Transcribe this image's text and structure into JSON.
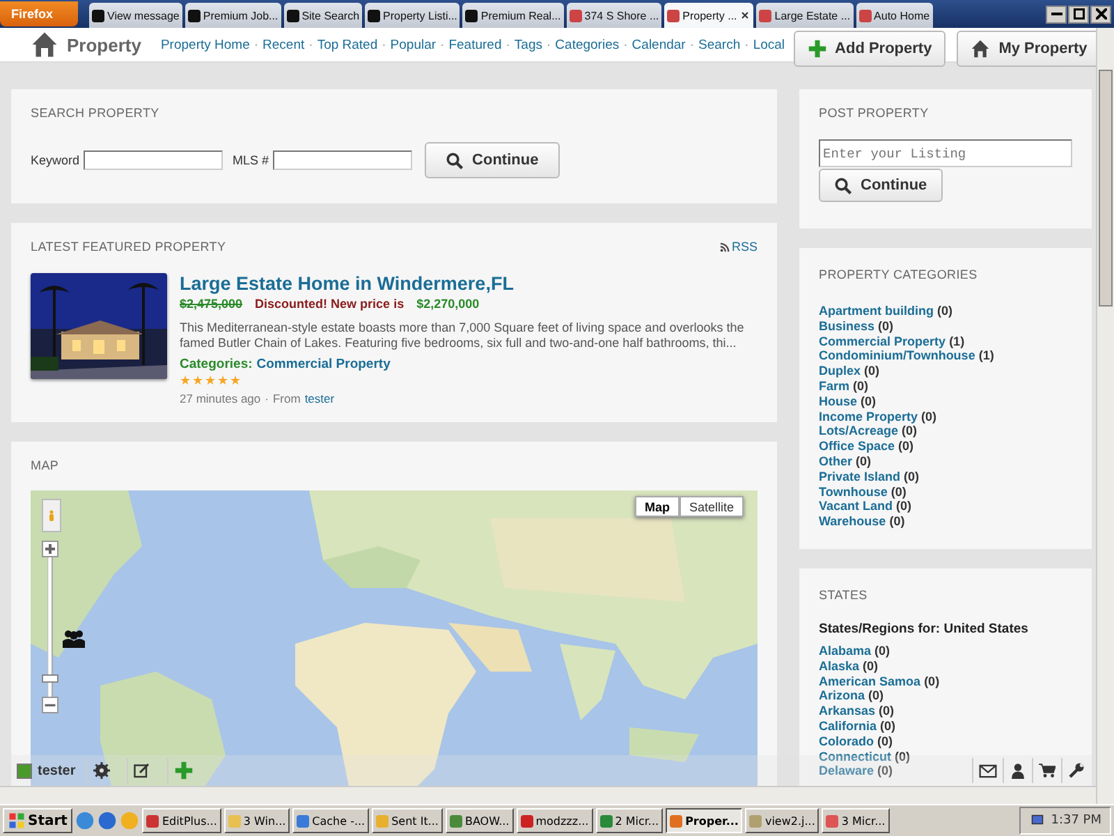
{
  "browser": {
    "menu_button": "Firefox",
    "tabs": [
      {
        "title": "View message",
        "selected": false
      },
      {
        "title": "Premium Job...",
        "selected": false
      },
      {
        "title": "Site Search",
        "selected": false
      },
      {
        "title": "Property Listi...",
        "selected": false
      },
      {
        "title": "Premium Real...",
        "selected": false
      },
      {
        "title": "374 S Shore ...",
        "selected": false
      },
      {
        "title": "Property ...",
        "selected": true
      },
      {
        "title": "Large Estate ...",
        "selected": false
      },
      {
        "title": "Auto Home",
        "selected": false
      }
    ]
  },
  "header": {
    "title": "Property",
    "nav_separator": "·",
    "nav": [
      "Property Home",
      "Recent",
      "Top Rated",
      "Popular",
      "Featured",
      "Tags",
      "Categories",
      "Calendar",
      "Search",
      "Local"
    ],
    "buttons": [
      {
        "label": "Add Property",
        "kind": "add"
      },
      {
        "label": "My Property",
        "kind": "home"
      }
    ]
  },
  "search": {
    "heading": "SEARCH PROPERTY",
    "keyword_label": "Keyword",
    "mls_label": "MLS #",
    "button": "Continue"
  },
  "featured": {
    "heading": "LATEST FEATURED PROPERTY",
    "rss": "RSS",
    "title": "Large Estate Home in Windermere,FL",
    "old_price": "$2,475,000",
    "discount_text": "Discounted! New price is",
    "new_price": "$2,270,000",
    "description": "This Mediterranean-style estate boasts more than 7,000 Square feet of living space and overlooks the famed Butler Chain of Lakes.  Featuring five bedrooms, six full and two-and-one half bathrooms, thi...",
    "categories_label": "Categories:",
    "category": "Commercial Property",
    "stars": 5,
    "time": "27 minutes ago",
    "meta_separator": "·",
    "from_label": "From",
    "author": "tester"
  },
  "map": {
    "heading": "MAP",
    "zoom": {
      "level": 0.1
    },
    "map_types": [
      {
        "label": "Map",
        "selected": true
      },
      {
        "label": "Satellite",
        "selected": false
      }
    ]
  },
  "post": {
    "heading": "POST PROPERTY",
    "placeholder": "Enter your Listing",
    "button": "Continue"
  },
  "categories": {
    "heading": "PROPERTY CATEGORIES",
    "items": [
      {
        "name": "Apartment building",
        "count": "(0)"
      },
      {
        "name": "Business",
        "count": "(0)"
      },
      {
        "name": "Commercial Property",
        "count": "(1)"
      },
      {
        "name": "Condominium/Townhouse",
        "count": "(1)"
      },
      {
        "name": "Duplex",
        "count": "(0)"
      },
      {
        "name": "Farm",
        "count": "(0)"
      },
      {
        "name": "House",
        "count": "(0)"
      },
      {
        "name": "Income Property",
        "count": "(0)"
      },
      {
        "name": "Lots/Acreage",
        "count": "(0)"
      },
      {
        "name": "Office Space",
        "count": "(0)"
      },
      {
        "name": "Other",
        "count": "(0)"
      },
      {
        "name": "Private Island",
        "count": "(0)"
      },
      {
        "name": "Townhouse",
        "count": "(0)"
      },
      {
        "name": "Vacant Land",
        "count": "(0)"
      },
      {
        "name": "Warehouse",
        "count": "(0)"
      }
    ]
  },
  "states": {
    "heading": "STATES",
    "subheading": "States/Regions for: United States",
    "items": [
      {
        "name": "Alabama",
        "count": "(0)"
      },
      {
        "name": "Alaska",
        "count": "(0)"
      },
      {
        "name": "American Samoa",
        "count": "(0)"
      },
      {
        "name": "Arizona",
        "count": "(0)"
      },
      {
        "name": "Arkansas",
        "count": "(0)"
      },
      {
        "name": "California",
        "count": "(0)"
      },
      {
        "name": "Colorado",
        "count": "(0)"
      },
      {
        "name": "Connecticut",
        "count": "(0)"
      },
      {
        "name": "Delaware",
        "count": "(0)"
      }
    ]
  },
  "member_bar": {
    "user": "tester"
  },
  "taskbar": {
    "start": "Start",
    "items": [
      {
        "label": "EditPlus...",
        "selected": false
      },
      {
        "label": "3 Win...",
        "selected": false
      },
      {
        "label": "Cache -...",
        "selected": false
      },
      {
        "label": "Sent It...",
        "selected": false
      },
      {
        "label": "BAOW...",
        "selected": false
      },
      {
        "label": "modzzz...",
        "selected": false
      },
      {
        "label": "2 Micr...",
        "selected": false
      },
      {
        "label": "Proper...",
        "selected": true
      },
      {
        "label": "view2.j...",
        "selected": false
      },
      {
        "label": "3 Micr...",
        "selected": false
      }
    ],
    "clock": "1:37 PM"
  }
}
